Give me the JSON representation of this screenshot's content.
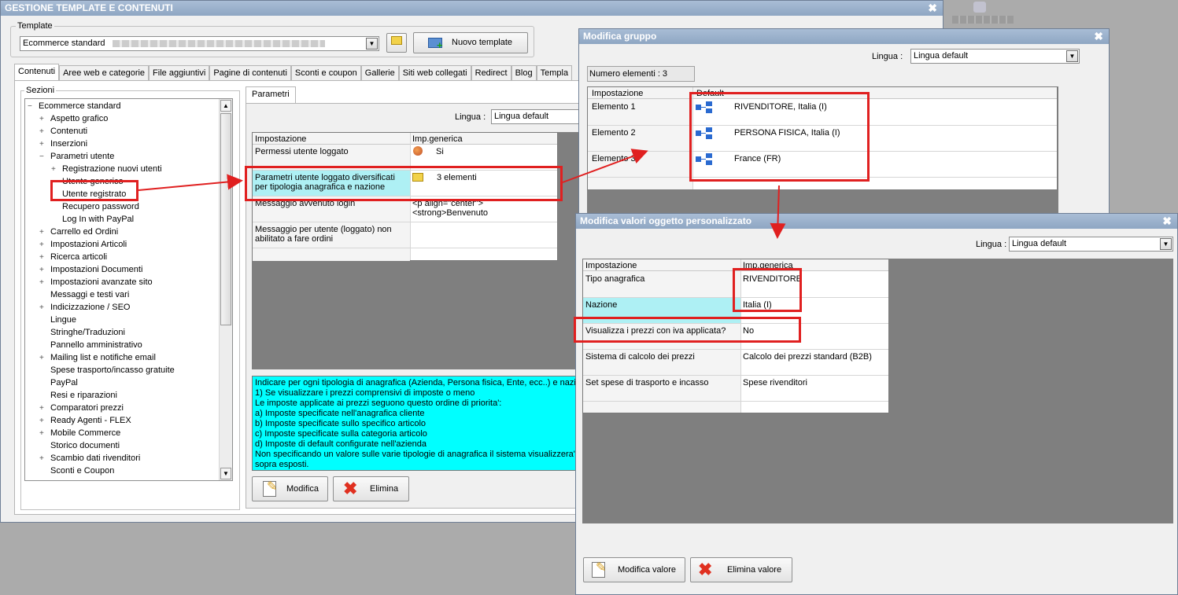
{
  "main": {
    "title": "GESTIONE TEMPLATE E CONTENUTI",
    "template_label": "Template",
    "template_value": "Ecommerce standard",
    "new_template_label": "Nuovo template",
    "tabs": [
      "Contenuti",
      "Aree web e categorie",
      "File aggiuntivi",
      "Pagine di contenuti",
      "Sconti e coupon",
      "Gallerie",
      "Siti web collegati",
      "Redirect",
      "Blog",
      "Templa"
    ],
    "sections_label": "Sezioni",
    "tree": [
      {
        "label": "Ecommerce standard",
        "exp": "−"
      },
      {
        "label": "Aspetto grafico",
        "exp": "+"
      },
      {
        "label": "Contenuti",
        "exp": "+"
      },
      {
        "label": "Inserzioni",
        "exp": "+"
      },
      {
        "label": "Parametri utente",
        "exp": "−"
      },
      {
        "label": "Registrazione nuovi utenti",
        "exp": "+"
      },
      {
        "label": "Utente generico",
        "exp": ""
      },
      {
        "label": "Utente registrato",
        "exp": ""
      },
      {
        "label": "Recupero password",
        "exp": ""
      },
      {
        "label": "Log In with PayPal",
        "exp": ""
      },
      {
        "label": "Carrello ed Ordini",
        "exp": "+"
      },
      {
        "label": "Impostazioni Articoli",
        "exp": "+"
      },
      {
        "label": "Ricerca articoli",
        "exp": "+"
      },
      {
        "label": "Impostazioni Documenti",
        "exp": "+"
      },
      {
        "label": "Impostazioni avanzate sito",
        "exp": "+"
      },
      {
        "label": "Messaggi e testi vari",
        "exp": ""
      },
      {
        "label": "Indicizzazione / SEO",
        "exp": "+"
      },
      {
        "label": "Lingue",
        "exp": ""
      },
      {
        "label": "Stringhe/Traduzioni",
        "exp": ""
      },
      {
        "label": "Pannello amministrativo",
        "exp": ""
      },
      {
        "label": "Mailing list e notifiche email",
        "exp": "+"
      },
      {
        "label": "Spese trasporto/incasso gratuite",
        "exp": ""
      },
      {
        "label": "PayPal",
        "exp": ""
      },
      {
        "label": "Resi e riparazioni",
        "exp": ""
      },
      {
        "label": "Comparatori prezzi",
        "exp": "+"
      },
      {
        "label": "Ready Agenti - FLEX",
        "exp": "+"
      },
      {
        "label": "Mobile Commerce",
        "exp": "+"
      },
      {
        "label": "Storico documenti",
        "exp": ""
      },
      {
        "label": "Scambio dati rivenditori",
        "exp": "+"
      },
      {
        "label": "Sconti e Coupon",
        "exp": ""
      }
    ],
    "params_tab": "Parametri",
    "lingua_label": "Lingua :",
    "lingua_value": "Lingua default",
    "grid_headers": [
      "Impostazione",
      "Imp.generica"
    ],
    "grid_rows": [
      {
        "setting": "Permessi utente loggato",
        "value": "Si"
      },
      {
        "setting": "Parametri utente loggato diversificati per tipologia anagrafica e nazione",
        "value": "3 elementi"
      },
      {
        "setting": "Messaggio avvenuto login",
        "value": "<p align=\"center\"><strong>Benvenuto"
      },
      {
        "setting": "Messaggio per utente (loggato) non abilitato a fare ordini",
        "value": ""
      }
    ],
    "help_lines": [
      "Indicare per ogni tipologia di anagrafica (Azienda, Persona fisica, Ente, ecc..) e nazion",
      "1) Se visualizzare i prezzi comprensivi di imposte o meno",
      "Le imposte applicate ai prezzi seguono questo ordine di priorita':",
      "a) Imposte specificate nell'anagrafica cliente",
      "b) Imposte specificate sullo specifico articolo",
      "c) Imposte specificate sulla categoria articolo",
      "d) Imposte di default configurate nell'azienda",
      "Non specificando un valore sulle varie tipologie di anagrafica il sistema visualizzera' di d",
      "sopra esposti."
    ],
    "modify_label": "Modifica",
    "delete_label": "Elimina"
  },
  "group": {
    "title": "Modifica gruppo",
    "lingua_label": "Lingua :",
    "lingua_value": "Lingua default",
    "count_label": "Numero elementi : 3",
    "headers": [
      "Impostazione",
      "Default"
    ],
    "rows": [
      {
        "label": "Elemento 1",
        "value": "RIVENDITORE, Italia (I)"
      },
      {
        "label": "Elemento 2",
        "value": "PERSONA FISICA, Italia (I)"
      },
      {
        "label": "Elemento 3",
        "value": "France (FR)"
      }
    ]
  },
  "custom": {
    "title": "Modifica valori oggetto personalizzato",
    "lingua_label": "Lingua :",
    "lingua_value": "Lingua default",
    "headers": [
      "Impostazione",
      "Imp.generica"
    ],
    "rows": [
      {
        "setting": "Tipo anagrafica",
        "value": "RIVENDITORE"
      },
      {
        "setting": "Nazione",
        "value": "Italia (I)"
      },
      {
        "setting": "Visualizza i prezzi con iva applicata?",
        "value": "No"
      },
      {
        "setting": "Sistema di calcolo dei prezzi",
        "value": "Calcolo dei prezzi standard (B2B)"
      },
      {
        "setting": "Set spese di trasporto e incasso",
        "value": "Spese rivenditori"
      }
    ],
    "modify_label": "Modifica valore",
    "delete_label": "Elimina valore"
  },
  "colors": {
    "highlight_cyan": "#aef0f4",
    "help_bg": "#00ffff",
    "annotation_red": "#e02020",
    "title_bar": "#8ea6c3"
  }
}
